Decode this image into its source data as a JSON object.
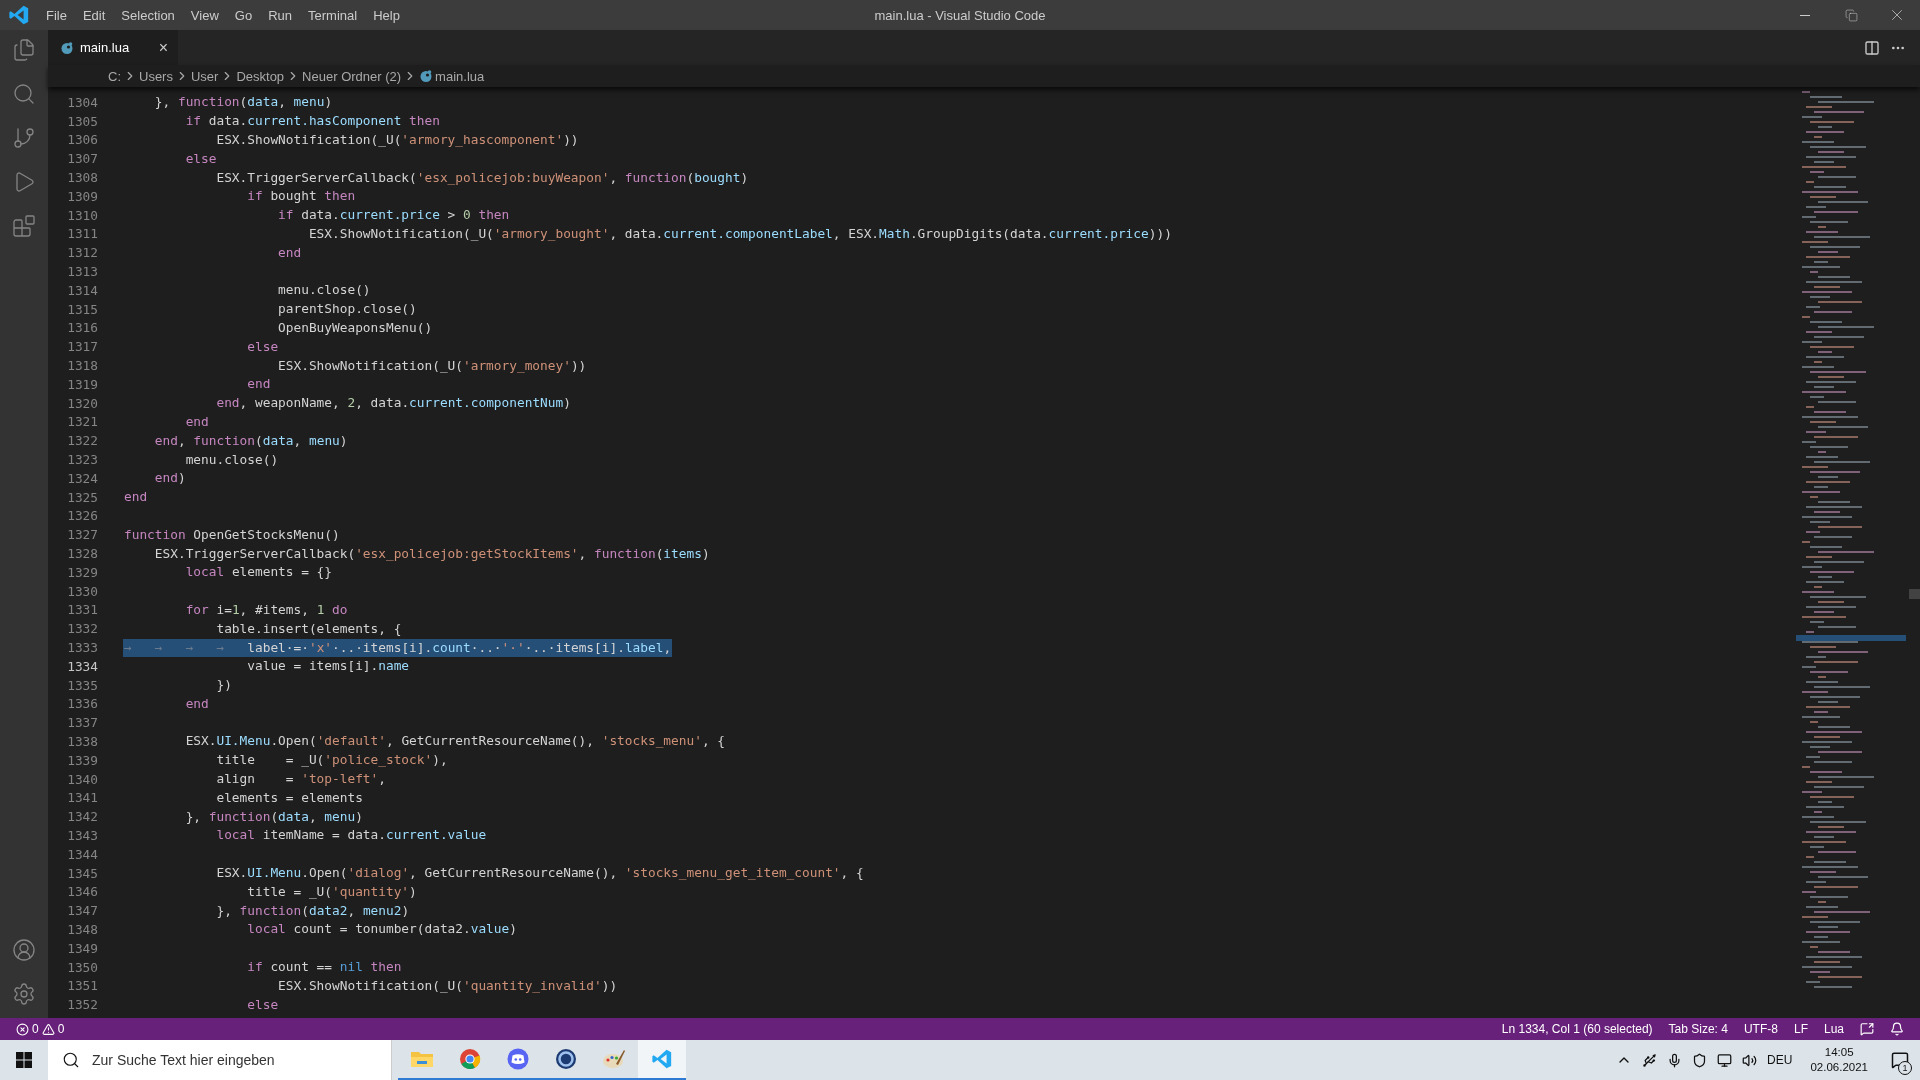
{
  "window": {
    "title": "main.lua - Visual Studio Code"
  },
  "menu": [
    "File",
    "Edit",
    "Selection",
    "View",
    "Go",
    "Run",
    "Terminal",
    "Help"
  ],
  "tabs": [
    {
      "label": "main.lua",
      "close": "×",
      "selected": true
    }
  ],
  "breadcrumb": [
    "C:",
    "Users",
    "User",
    "Desktop",
    "Neuer Ordner (2)",
    "main.lua"
  ],
  "editor": {
    "lines": [
      {
        "number": "1304",
        "selected": false,
        "current": false,
        "tokens": [
          {
            "kind": "plain",
            "text": "    }, "
          },
          {
            "kind": "keyword",
            "text": "function"
          },
          {
            "kind": "plain",
            "text": "("
          },
          {
            "kind": "variable",
            "text": "data"
          },
          {
            "kind": "plain",
            "text": ", "
          },
          {
            "kind": "variable",
            "text": "menu"
          },
          {
            "kind": "plain",
            "text": ")"
          }
        ]
      },
      {
        "number": "1305",
        "selected": false,
        "current": false,
        "tokens": [
          {
            "kind": "keyword",
            "text": "        if"
          },
          {
            "kind": "plain",
            "text": " data."
          },
          {
            "kind": "variable",
            "text": "current.hasComponent"
          },
          {
            "kind": "keyword",
            "text": " then"
          }
        ]
      },
      {
        "number": "1306",
        "selected": false,
        "current": false,
        "tokens": [
          {
            "kind": "plain",
            "text": "            ESX.ShowNotification(_U("
          },
          {
            "kind": "string",
            "text": "'armory_hascomponent'"
          },
          {
            "kind": "plain",
            "text": "))"
          }
        ]
      },
      {
        "number": "1307",
        "selected": false,
        "current": false,
        "tokens": [
          {
            "kind": "keyword",
            "text": "        else"
          }
        ]
      },
      {
        "number": "1308",
        "selected": false,
        "current": false,
        "tokens": [
          {
            "kind": "plain",
            "text": "            ESX.TriggerServerCallback("
          },
          {
            "kind": "string",
            "text": "'esx_policejob:buyWeapon'"
          },
          {
            "kind": "plain",
            "text": ", "
          },
          {
            "kind": "keyword",
            "text": "function"
          },
          {
            "kind": "plain",
            "text": "("
          },
          {
            "kind": "variable",
            "text": "bought"
          },
          {
            "kind": "plain",
            "text": ")"
          }
        ]
      },
      {
        "number": "1309",
        "selected": false,
        "current": false,
        "tokens": [
          {
            "kind": "keyword",
            "text": "                if"
          },
          {
            "kind": "plain",
            "text": " bought"
          },
          {
            "kind": "keyword",
            "text": " then"
          }
        ]
      },
      {
        "number": "1310",
        "selected": false,
        "current": false,
        "tokens": [
          {
            "kind": "keyword",
            "text": "                    if"
          },
          {
            "kind": "plain",
            "text": " data."
          },
          {
            "kind": "variable",
            "text": "current.price"
          },
          {
            "kind": "plain",
            "text": " > "
          },
          {
            "kind": "number",
            "text": "0"
          },
          {
            "kind": "keyword",
            "text": " then"
          }
        ]
      },
      {
        "number": "1311",
        "selected": false,
        "current": false,
        "tokens": [
          {
            "kind": "plain",
            "text": "                        ESX.ShowNotification(_U("
          },
          {
            "kind": "string",
            "text": "'armory_bought'"
          },
          {
            "kind": "plain",
            "text": ", data."
          },
          {
            "kind": "variable",
            "text": "current.componentLabel"
          },
          {
            "kind": "plain",
            "text": ", ESX."
          },
          {
            "kind": "variable",
            "text": "Math"
          },
          {
            "kind": "plain",
            "text": ".GroupDigits(data."
          },
          {
            "kind": "variable",
            "text": "current.price"
          },
          {
            "kind": "plain",
            "text": ")))"
          }
        ]
      },
      {
        "number": "1312",
        "selected": false,
        "current": false,
        "tokens": [
          {
            "kind": "keyword",
            "text": "                    end"
          }
        ]
      },
      {
        "number": "1313",
        "selected": false,
        "current": false
      },
      {
        "number": "1314",
        "selected": false,
        "current": false,
        "tokens": [
          {
            "kind": "plain",
            "text": "                    menu.close()"
          }
        ]
      },
      {
        "number": "1315",
        "selected": false,
        "current": false,
        "tokens": [
          {
            "kind": "plain",
            "text": "                    parentShop.close()"
          }
        ]
      },
      {
        "number": "1316",
        "selected": false,
        "current": false,
        "tokens": [
          {
            "kind": "plain",
            "text": "                    OpenBuyWeaponsMenu()"
          }
        ]
      },
      {
        "number": "1317",
        "selected": false,
        "current": false,
        "tokens": [
          {
            "kind": "keyword",
            "text": "                else"
          }
        ]
      },
      {
        "number": "1318",
        "selected": false,
        "current": false,
        "tokens": [
          {
            "kind": "plain",
            "text": "                    ESX.ShowNotification(_U("
          },
          {
            "kind": "string",
            "text": "'armory_money'"
          },
          {
            "kind": "plain",
            "text": "))"
          }
        ]
      },
      {
        "number": "1319",
        "selected": false,
        "current": false,
        "tokens": [
          {
            "kind": "keyword",
            "text": "                end"
          }
        ]
      },
      {
        "number": "1320",
        "selected": false,
        "current": false,
        "tokens": [
          {
            "kind": "keyword",
            "text": "            end"
          },
          {
            "kind": "plain",
            "text": ", weaponName, "
          },
          {
            "kind": "number",
            "text": "2"
          },
          {
            "kind": "plain",
            "text": ", data."
          },
          {
            "kind": "variable",
            "text": "current.componentNum"
          },
          {
            "kind": "plain",
            "text": ")"
          }
        ]
      },
      {
        "number": "1321",
        "selected": false,
        "current": false,
        "tokens": [
          {
            "kind": "keyword",
            "text": "        end"
          }
        ]
      },
      {
        "number": "1322",
        "selected": false,
        "current": false,
        "tokens": [
          {
            "kind": "keyword",
            "text": "    end"
          },
          {
            "kind": "plain",
            "text": ", "
          },
          {
            "kind": "keyword",
            "text": "function"
          },
          {
            "kind": "plain",
            "text": "("
          },
          {
            "kind": "variable",
            "text": "data"
          },
          {
            "kind": "plain",
            "text": ", "
          },
          {
            "kind": "variable",
            "text": "menu"
          },
          {
            "kind": "plain",
            "text": ")"
          }
        ]
      },
      {
        "number": "1323",
        "selected": false,
        "current": false,
        "tokens": [
          {
            "kind": "plain",
            "text": "        menu.close()"
          }
        ]
      },
      {
        "number": "1324",
        "selected": false,
        "current": false,
        "tokens": [
          {
            "kind": "keyword",
            "text": "    end"
          },
          {
            "kind": "plain",
            "text": ")"
          }
        ]
      },
      {
        "number": "1325",
        "selected": false,
        "current": false,
        "tokens": [
          {
            "kind": "keyword",
            "text": "end"
          }
        ]
      },
      {
        "number": "1326",
        "selected": false,
        "current": false
      },
      {
        "number": "1327",
        "selected": false,
        "current": false,
        "tokens": [
          {
            "kind": "keyword",
            "text": "function"
          },
          {
            "kind": "plain",
            "text": " OpenGetStocksMenu()"
          }
        ]
      },
      {
        "number": "1328",
        "selected": false,
        "current": false,
        "tokens": [
          {
            "kind": "plain",
            "text": "    ESX.TriggerServerCallback("
          },
          {
            "kind": "string",
            "text": "'esx_policejob:getStockItems'"
          },
          {
            "kind": "plain",
            "text": ", "
          },
          {
            "kind": "keyword",
            "text": "function"
          },
          {
            "kind": "plain",
            "text": "("
          },
          {
            "kind": "variable",
            "text": "items"
          },
          {
            "kind": "plain",
            "text": ")"
          }
        ]
      },
      {
        "number": "1329",
        "selected": false,
        "current": false,
        "tokens": [
          {
            "kind": "keyword",
            "text": "        local"
          },
          {
            "kind": "plain",
            "text": " elements = {}"
          }
        ]
      },
      {
        "number": "1330",
        "selected": false,
        "current": false
      },
      {
        "number": "1331",
        "selected": false,
        "current": false,
        "tokens": [
          {
            "kind": "keyword",
            "text": "        for"
          },
          {
            "kind": "plain",
            "text": " i="
          },
          {
            "kind": "number",
            "text": "1"
          },
          {
            "kind": "plain",
            "text": ", #items, "
          },
          {
            "kind": "number",
            "text": "1"
          },
          {
            "kind": "keyword",
            "text": " do"
          }
        ]
      },
      {
        "number": "1332",
        "selected": false,
        "current": false,
        "tokens": [
          {
            "kind": "plain",
            "text": "            table.insert(elements, {"
          }
        ]
      },
      {
        "number": "1333",
        "selected": true,
        "current": false,
        "tokens": [
          {
            "kind": "whitespace",
            "text": "→   →   →   →   "
          },
          {
            "kind": "plain",
            "text": "label·=·"
          },
          {
            "kind": "string",
            "text": "'x'"
          },
          {
            "kind": "plain",
            "text": "·..·items[i]."
          },
          {
            "kind": "variable",
            "text": "count"
          },
          {
            "kind": "plain",
            "text": "·..·"
          },
          {
            "kind": "string",
            "text": "'·'"
          },
          {
            "kind": "plain",
            "text": "·..·items[i]."
          },
          {
            "kind": "variable",
            "text": "label"
          },
          {
            "kind": "plain",
            "text": ","
          }
        ]
      },
      {
        "number": "1334",
        "selected": false,
        "current": true,
        "tokens": [
          {
            "kind": "plain",
            "text": "                value = items[i]."
          },
          {
            "kind": "variable",
            "text": "name"
          }
        ]
      },
      {
        "number": "1335",
        "selected": false,
        "current": false,
        "tokens": [
          {
            "kind": "plain",
            "text": "            })"
          }
        ]
      },
      {
        "number": "1336",
        "selected": false,
        "current": false,
        "tokens": [
          {
            "kind": "keyword",
            "text": "        end"
          }
        ]
      },
      {
        "number": "1337",
        "selected": false,
        "current": false
      },
      {
        "number": "1338",
        "selected": false,
        "current": false,
        "tokens": [
          {
            "kind": "plain",
            "text": "        ESX."
          },
          {
            "kind": "variable",
            "text": "UI.Menu"
          },
          {
            "kind": "plain",
            "text": ".Open("
          },
          {
            "kind": "string",
            "text": "'default'"
          },
          {
            "kind": "plain",
            "text": ", GetCurrentResourceName(), "
          },
          {
            "kind": "string",
            "text": "'stocks_menu'"
          },
          {
            "kind": "plain",
            "text": ", {"
          }
        ]
      },
      {
        "number": "1339",
        "selected": false,
        "current": false,
        "tokens": [
          {
            "kind": "plain",
            "text": "            title    = _U("
          },
          {
            "kind": "string",
            "text": "'police_stock'"
          },
          {
            "kind": "plain",
            "text": "),"
          }
        ]
      },
      {
        "number": "1340",
        "selected": false,
        "current": false,
        "tokens": [
          {
            "kind": "plain",
            "text": "            align    = "
          },
          {
            "kind": "string",
            "text": "'top-left'"
          },
          {
            "kind": "plain",
            "text": ","
          }
        ]
      },
      {
        "number": "1341",
        "selected": false,
        "current": false,
        "tokens": [
          {
            "kind": "plain",
            "text": "            elements = elements"
          }
        ]
      },
      {
        "number": "1342",
        "selected": false,
        "current": false,
        "tokens": [
          {
            "kind": "plain",
            "text": "        }, "
          },
          {
            "kind": "keyword",
            "text": "function"
          },
          {
            "kind": "plain",
            "text": "("
          },
          {
            "kind": "variable",
            "text": "data"
          },
          {
            "kind": "plain",
            "text": ", "
          },
          {
            "kind": "variable",
            "text": "menu"
          },
          {
            "kind": "plain",
            "text": ")"
          }
        ]
      },
      {
        "number": "1343",
        "selected": false,
        "current": false,
        "tokens": [
          {
            "kind": "keyword",
            "text": "            local"
          },
          {
            "kind": "plain",
            "text": " itemName = data."
          },
          {
            "kind": "variable",
            "text": "current.value"
          }
        ]
      },
      {
        "number": "1344",
        "selected": false,
        "current": false
      },
      {
        "number": "1345",
        "selected": false,
        "current": false,
        "tokens": [
          {
            "kind": "plain",
            "text": "            ESX."
          },
          {
            "kind": "variable",
            "text": "UI.Menu"
          },
          {
            "kind": "plain",
            "text": ".Open("
          },
          {
            "kind": "string",
            "text": "'dialog'"
          },
          {
            "kind": "plain",
            "text": ", GetCurrentResourceName(), "
          },
          {
            "kind": "string",
            "text": "'stocks_menu_get_item_count'"
          },
          {
            "kind": "plain",
            "text": ", {"
          }
        ]
      },
      {
        "number": "1346",
        "selected": false,
        "current": false,
        "tokens": [
          {
            "kind": "plain",
            "text": "                title = _U("
          },
          {
            "kind": "string",
            "text": "'quantity'"
          },
          {
            "kind": "plain",
            "text": ")"
          }
        ]
      },
      {
        "number": "1347",
        "selected": false,
        "current": false,
        "tokens": [
          {
            "kind": "plain",
            "text": "            }, "
          },
          {
            "kind": "keyword",
            "text": "function"
          },
          {
            "kind": "plain",
            "text": "("
          },
          {
            "kind": "variable",
            "text": "data2"
          },
          {
            "kind": "plain",
            "text": ", "
          },
          {
            "kind": "variable",
            "text": "menu2"
          },
          {
            "kind": "plain",
            "text": ")"
          }
        ]
      },
      {
        "number": "1348",
        "selected": false,
        "current": false,
        "tokens": [
          {
            "kind": "keyword",
            "text": "                local"
          },
          {
            "kind": "plain",
            "text": " count = tonumber(data2."
          },
          {
            "kind": "variable",
            "text": "value"
          },
          {
            "kind": "plain",
            "text": ")"
          }
        ]
      },
      {
        "number": "1349",
        "selected": false,
        "current": false
      },
      {
        "number": "1350",
        "selected": false,
        "current": false,
        "tokens": [
          {
            "kind": "keyword",
            "text": "                if"
          },
          {
            "kind": "plain",
            "text": " count == "
          },
          {
            "kind": "constant",
            "text": "nil"
          },
          {
            "kind": "keyword",
            "text": " then"
          }
        ]
      },
      {
        "number": "1351",
        "selected": false,
        "current": false,
        "tokens": [
          {
            "kind": "plain",
            "text": "                    ESX.ShowNotification(_U("
          },
          {
            "kind": "string",
            "text": "'quantity_invalid'"
          },
          {
            "kind": "plain",
            "text": "))"
          }
        ]
      },
      {
        "number": "1352",
        "selected": false,
        "current": false,
        "tokens": [
          {
            "kind": "keyword",
            "text": "                else"
          }
        ]
      }
    ]
  },
  "status_bar": {
    "errors": "0",
    "warnings": "0",
    "items": [
      "Ln 1334, Col 1 (60 selected)",
      "Tab Size: 4",
      "UTF-8",
      "LF",
      "Lua"
    ]
  },
  "taskbar": {
    "search": {
      "placeholder": "Zur Suche Text hier eingeben"
    },
    "apps": [
      {
        "kind": "folder",
        "selected": false
      },
      {
        "kind": "browser",
        "selected": false
      },
      {
        "kind": "chat",
        "selected": false
      },
      {
        "kind": "ring",
        "selected": false
      },
      {
        "kind": "palette",
        "selected": false
      },
      {
        "kind": "editor",
        "selected": true
      }
    ],
    "language": "DEU",
    "time": "14:05",
    "date": "02.06.2021",
    "notifications": "1"
  }
}
